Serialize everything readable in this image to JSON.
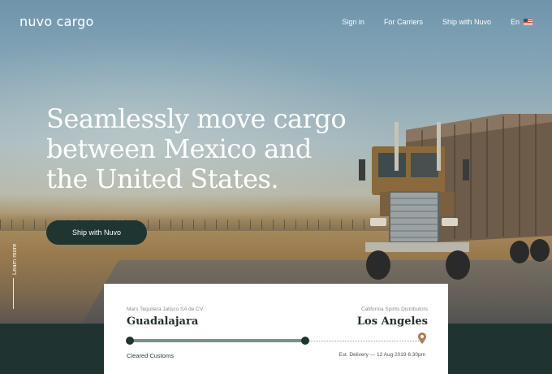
{
  "brand": {
    "logo": "nuvo cargo"
  },
  "nav": {
    "sign_in": "Sign in",
    "for_carriers": "For Carriers",
    "ship_with_nuvo": "Ship with Nuvo",
    "language": "En",
    "flag_icon": "us-flag-icon"
  },
  "hero": {
    "headline": "Seamlessly move cargo between Mexico and the United States.",
    "cta_label": "Ship with Nuvo",
    "learn_more": "Learn more"
  },
  "shipment": {
    "origin_company": "Mars Tequilera Jalisco SA de CV",
    "origin_city": "Guadalajara",
    "destination_company": "California Spirits Distributors",
    "destination_city": "Los Angeles",
    "status": "Cleared Customs",
    "eta": "Est. Delivery — 12 Aug 2019 6:30pm",
    "progress": 0.6,
    "pin_icon": "location-pin-icon"
  },
  "colors": {
    "brand_dark": "#1e3532",
    "progress": "#7c8f8a",
    "pin": "#a9825a"
  }
}
